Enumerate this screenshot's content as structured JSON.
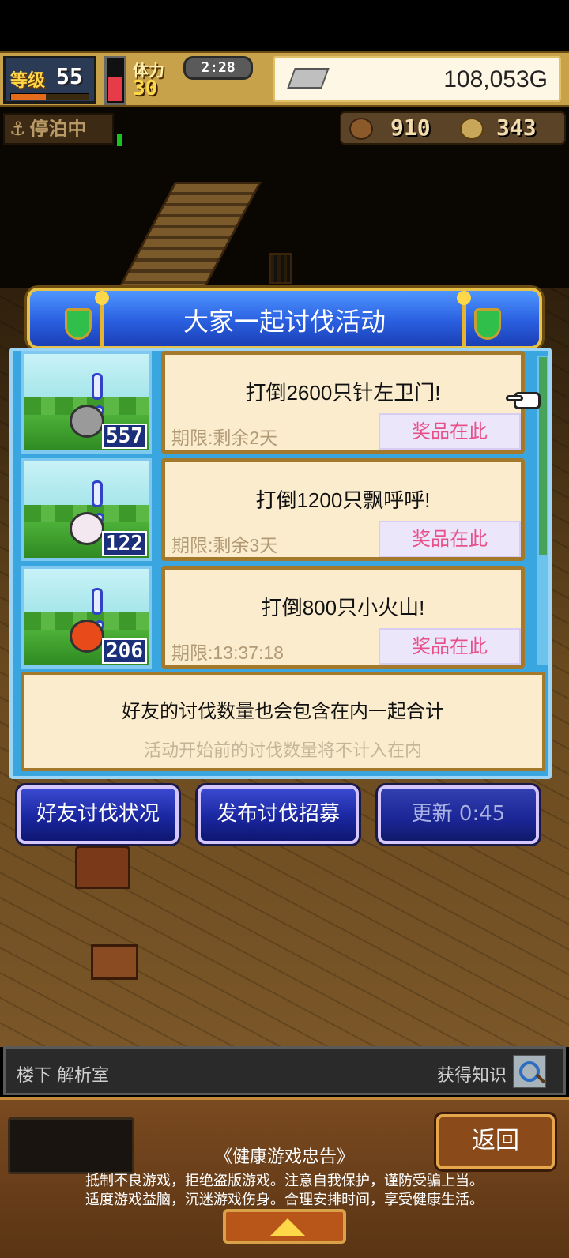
{
  "hud": {
    "level_label": "等级",
    "level_value": "55",
    "level_progress": 0.45,
    "stamina_label": "体力",
    "stamina_value": "30",
    "stamina_fill": 0.55,
    "timer": "2:28",
    "gold": "108,053G"
  },
  "status": {
    "docked": "停泊中",
    "anchor_icon": "anchor-icon"
  },
  "resources": {
    "wood_value": "910",
    "coin_value": "343"
  },
  "event": {
    "title": "大家一起讨伐活动",
    "rows": [
      {
        "count": "557",
        "title": "打倒2600只针左卫门!",
        "deadline": "期限:剩余2天",
        "prize": "奖品在此",
        "monster_color": "#9a9a9a"
      },
      {
        "count": "122",
        "title": "打倒1200只飘呼呼!",
        "deadline": "期限:剩余3天",
        "prize": "奖品在此",
        "monster_color": "#f4e8f0"
      },
      {
        "count": "206",
        "title": "打倒800只小火山!",
        "deadline": "期限:13:37:18",
        "prize": "奖品在此",
        "monster_color": "#e84a1a"
      }
    ],
    "info_main": "好友的讨伐数量也会包含在内一起合计",
    "info_sub": "活动开始前的讨伐数量将不计入在内"
  },
  "buttons": {
    "friend_status": "好友讨伐状况",
    "post_recruit": "发布讨伐招募",
    "refresh": "更新 0:45"
  },
  "location": {
    "place": "楼下 解析室",
    "knowledge": "获得知识"
  },
  "footer": {
    "back": "返回",
    "health_title": "《健康游戏忠告》",
    "health_line1": "抵制不良游戏，拒绝盗版游戏。注意自我保护，谨防受骗上当。",
    "health_line2": "适度游戏益脑，沉迷游戏伤身。合理安排时间，享受健康生活。"
  },
  "colors": {
    "header_blue": "#2a5fe0",
    "body_blue": "#3aa6e0",
    "card_bg": "#fbeccd",
    "prize_pink": "#e8508a"
  }
}
